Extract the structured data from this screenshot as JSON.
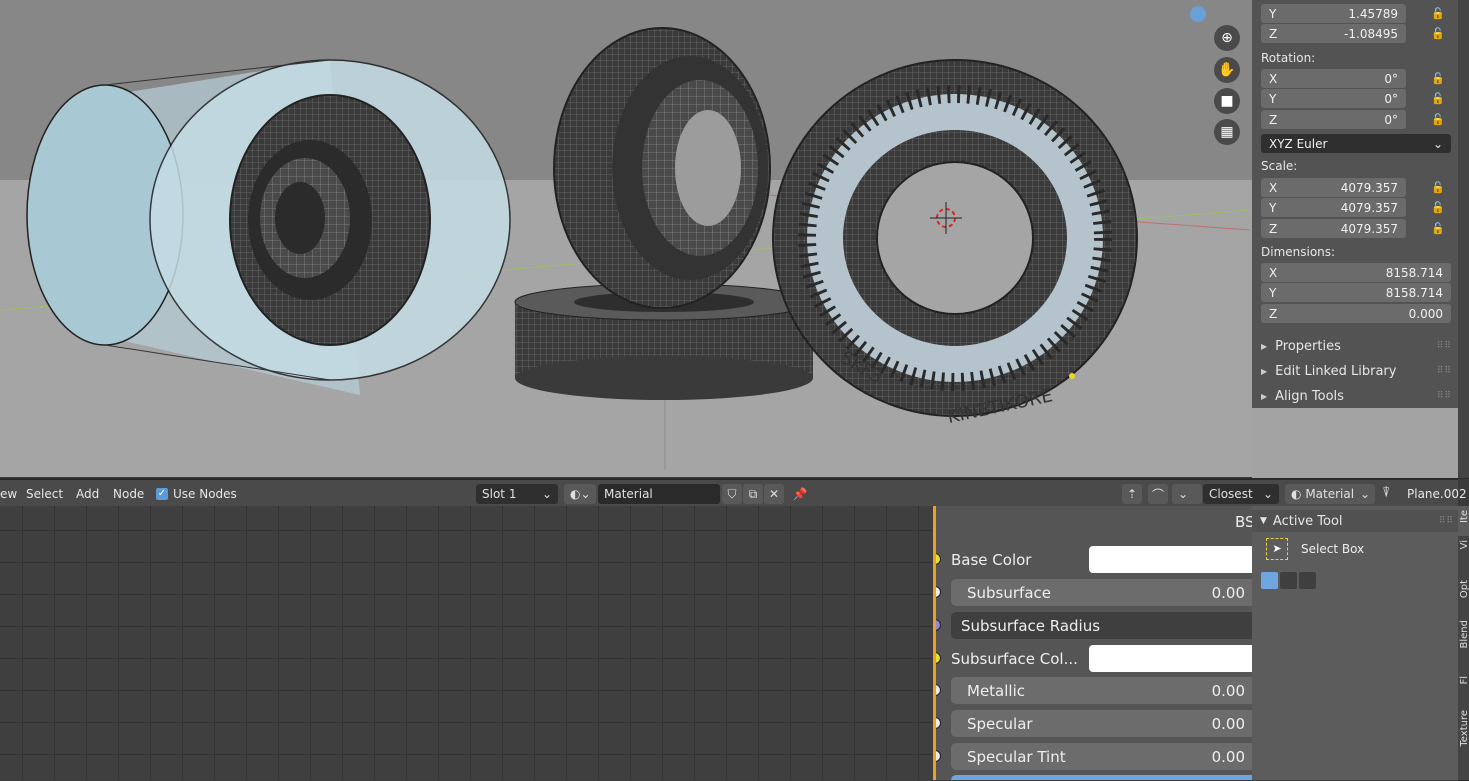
{
  "viewport": {
    "nav_icons": [
      "zoom-icon",
      "hand-pan-icon",
      "camera-icon",
      "perspective-grid-icon"
    ],
    "engraving": {
      "text1": "SKF3",
      "text2": "KINETIKORE"
    }
  },
  "npanel": {
    "location": {
      "y_label": "Y",
      "y": "1.45789",
      "z_label": "Z",
      "z": "-1.08495"
    },
    "rotation_label": "Rotation:",
    "rotation": [
      {
        "axis": "X",
        "value": "0°"
      },
      {
        "axis": "Y",
        "value": "0°"
      },
      {
        "axis": "Z",
        "value": "0°"
      }
    ],
    "rotation_mode": "XYZ Euler",
    "scale_label": "Scale:",
    "scale": [
      {
        "axis": "X",
        "value": "4079.357"
      },
      {
        "axis": "Y",
        "value": "4079.357"
      },
      {
        "axis": "Z",
        "value": "4079.357"
      }
    ],
    "dimensions_label": "Dimensions:",
    "dimensions": [
      {
        "axis": "X",
        "value": "8158.714"
      },
      {
        "axis": "Y",
        "value": "8158.714"
      },
      {
        "axis": "Z",
        "value": "0.000"
      }
    ],
    "sections": [
      "Properties",
      "Edit Linked Library",
      "Align Tools"
    ]
  },
  "node_header": {
    "menu": [
      "ew",
      "Select",
      "Add",
      "Node"
    ],
    "use_nodes_label": "Use Nodes",
    "slot": "Slot 1",
    "material_name": "Material",
    "snap": "Closest",
    "shading": "Material",
    "object": "Plane.002"
  },
  "node": {
    "title": "BS",
    "base_color_label": "Base Color",
    "subsurface_label": "Subsurface",
    "subsurface_value": "0.00",
    "subsurface_radius_label": "Subsurface Radius",
    "subsurface_color_label": "Subsurface Col...",
    "metallic_label": "Metallic",
    "metallic_value": "0.00",
    "specular_label": "Specular",
    "specular_value": "0.00",
    "specular_tint_label": "Specular Tint",
    "specular_tint_value": "0.00"
  },
  "toolpanel": {
    "header": "Active Tool",
    "tool_name": "Select Box"
  },
  "right_tabs": [
    "Ite",
    "Vi",
    "Opt",
    "Blend",
    "Fl",
    "Texture"
  ]
}
